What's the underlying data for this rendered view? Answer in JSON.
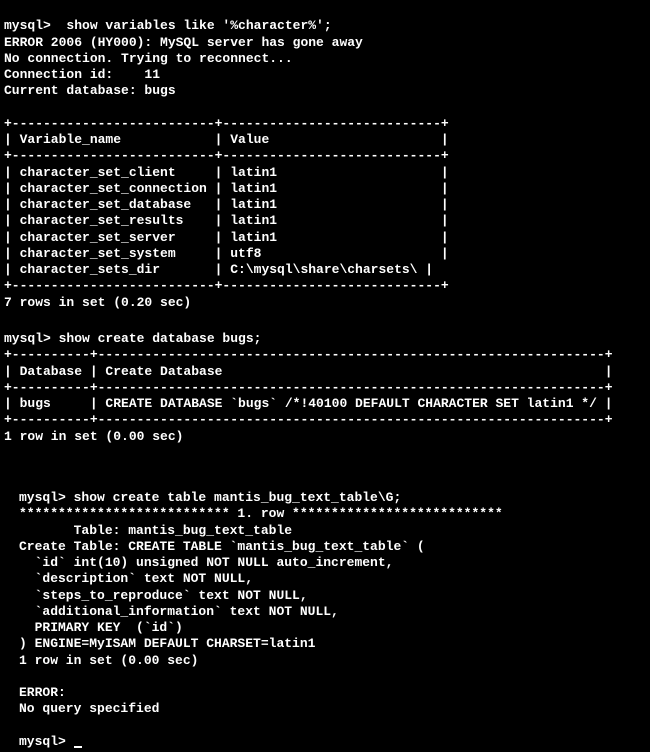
{
  "section1": {
    "prompt1": "mysql>  show variables like '%character%';",
    "error1": "ERROR 2006 (HY000): MySQL server has gone away",
    "reconnect": "No connection. Trying to reconnect...",
    "conn_id": "Connection id:    11",
    "curr_db": "Current database: bugs",
    "border_top": "+--------------------------+----------------------------+",
    "header": "| Variable_name            | Value                      |",
    "border_mid": "+--------------------------+----------------------------+",
    "rows": [
      "| character_set_client     | latin1                     |",
      "| character_set_connection | latin1                     |",
      "| character_set_database   | latin1                     |",
      "| character_set_results    | latin1                     |",
      "| character_set_server     | latin1                     |",
      "| character_set_system     | utf8                       |",
      "| character_sets_dir       | C:\\mysql\\share\\charsets\\ |"
    ],
    "border_bot": "+--------------------------+----------------------------+",
    "result": "7 rows in set (0.20 sec)"
  },
  "section2": {
    "prompt": "mysql> show create database bugs;",
    "border_top": "+----------+-----------------------------------------------------------------+",
    "header": "| Database | Create Database                                                 |",
    "border_mid": "+----------+-----------------------------------------------------------------+",
    "row": "| bugs     | CREATE DATABASE `bugs` /*!40100 DEFAULT CHARACTER SET latin1 */ |",
    "border_bot": "+----------+-----------------------------------------------------------------+",
    "result": "1 row in set (0.00 sec)"
  },
  "section3": {
    "prompt": "mysql> show create table mantis_bug_text_table\\G;",
    "row_header": "*************************** 1. row ***************************",
    "table_line": "       Table: mantis_bug_text_table",
    "create_lines": [
      "Create Table: CREATE TABLE `mantis_bug_text_table` (",
      "  `id` int(10) unsigned NOT NULL auto_increment,",
      "  `description` text NOT NULL,",
      "  `steps_to_reproduce` text NOT NULL,",
      "  `additional_information` text NOT NULL,",
      "  PRIMARY KEY  (`id`)",
      ") ENGINE=MyISAM DEFAULT CHARSET=latin1"
    ],
    "result": "1 row in set (0.00 sec)",
    "error": "ERROR:",
    "error_msg": "No query specified",
    "prompt_end": "mysql> "
  }
}
